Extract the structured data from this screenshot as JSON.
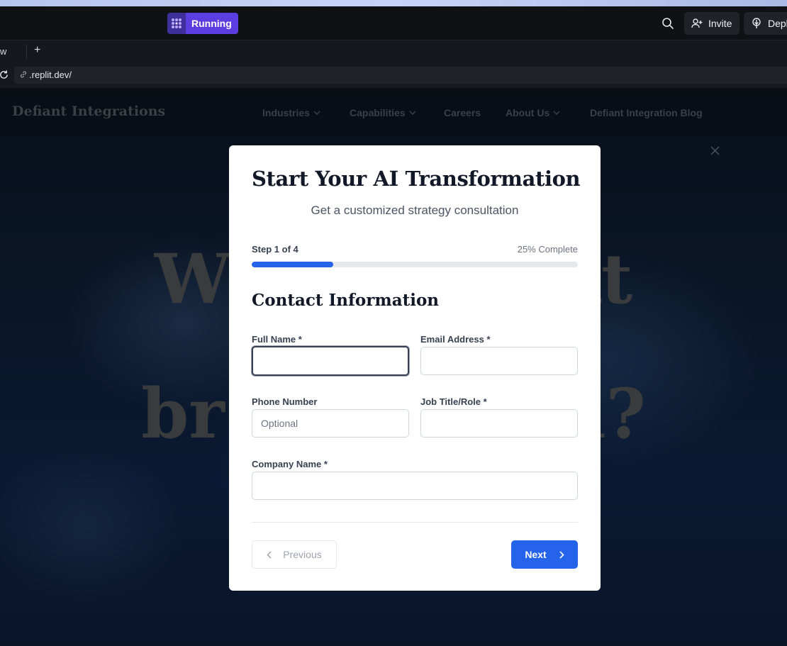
{
  "replit": {
    "status_label": "Running",
    "invite_label": "Invite",
    "deploy_label": "Depl",
    "tab_fragment": "w",
    "tab_add": "+",
    "url": ".replit.dev/"
  },
  "site": {
    "logo": "Defiant Integrations",
    "nav": {
      "industries": "Industries",
      "capabilities": "Capabilities",
      "careers": "Careers",
      "about": "About Us",
      "blog": "Defiant Integration Blog"
    },
    "hero_line1": "Wh          ext",
    "hero_line2": "br              h?"
  },
  "modal": {
    "title": "Start Your AI Transformation",
    "subtitle": "Get a customized strategy consultation",
    "step_label": "Step 1 of 4",
    "percent_label": "25% Complete",
    "progress_fraction": 0.25,
    "section_title": "Contact Information",
    "fields": {
      "full_name": {
        "label": "Full Name *",
        "value": "",
        "placeholder": ""
      },
      "email": {
        "label": "Email Address *",
        "value": "",
        "placeholder": ""
      },
      "phone": {
        "label": "Phone Number",
        "value": "",
        "placeholder": "Optional"
      },
      "job_title": {
        "label": "Job Title/Role *",
        "value": "",
        "placeholder": ""
      },
      "company": {
        "label": "Company Name *",
        "value": "",
        "placeholder": ""
      }
    },
    "previous_label": "Previous",
    "next_label": "Next"
  },
  "colors": {
    "accent": "#2563eb",
    "running": "#5a3ee0"
  }
}
